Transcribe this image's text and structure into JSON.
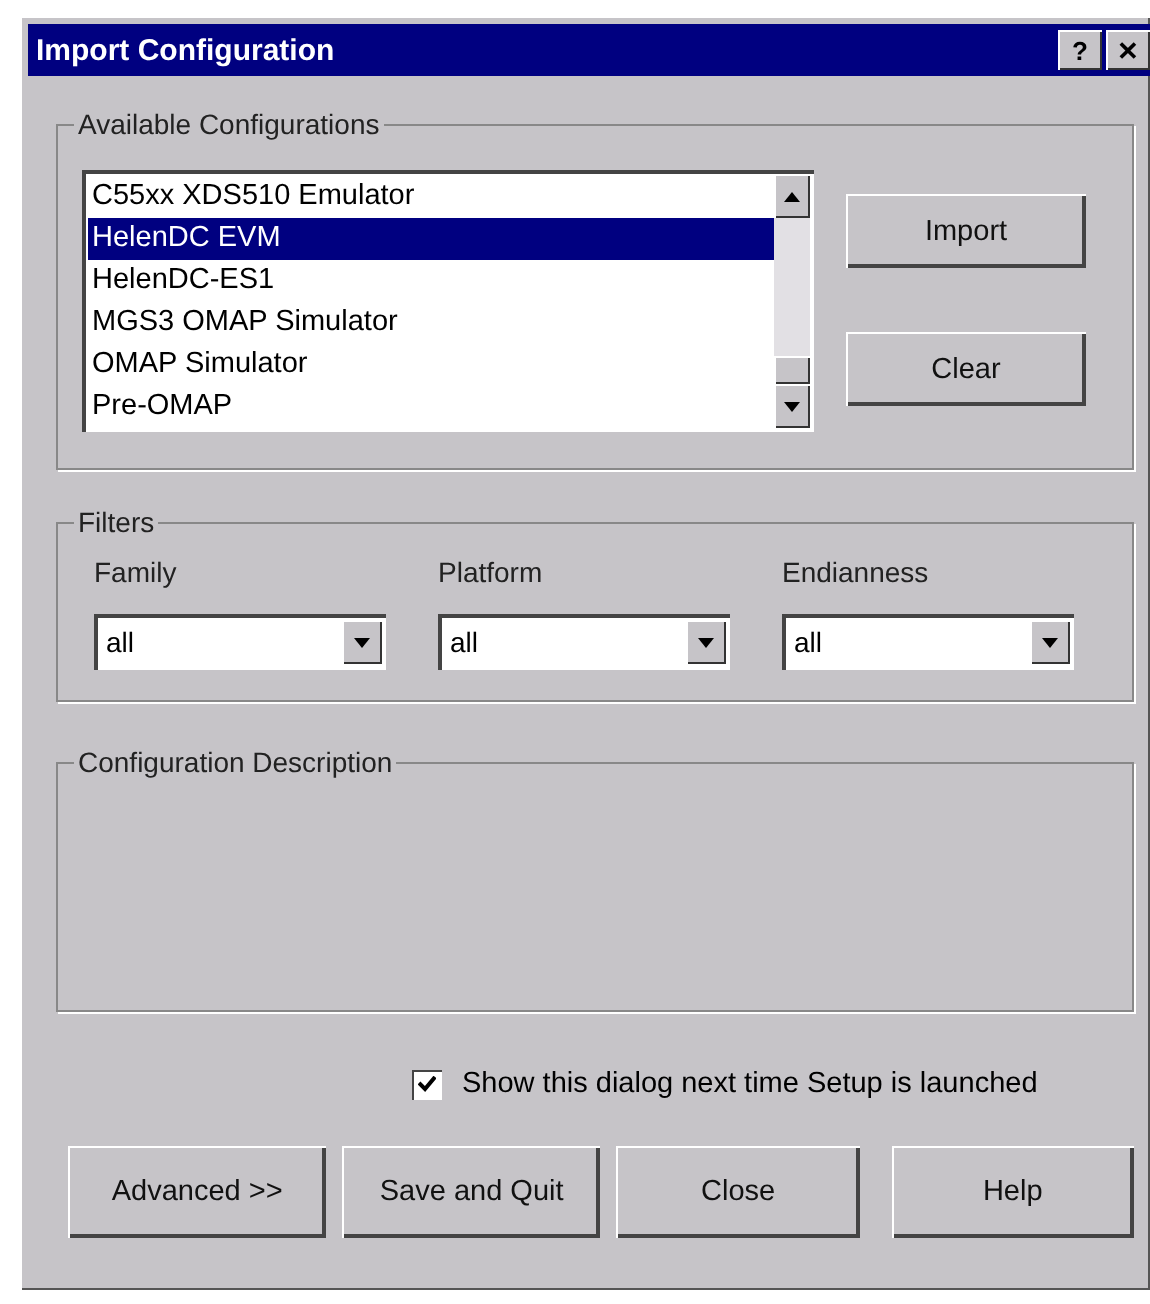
{
  "window": {
    "title": "Import Configuration",
    "help_button": "?",
    "close_button": "✕"
  },
  "available_configurations": {
    "label": "Available Configurations",
    "items": [
      {
        "label": "C55xx XDS510 Emulator",
        "selected": false
      },
      {
        "label": "HelenDC EVM",
        "selected": true
      },
      {
        "label": "HelenDC-ES1",
        "selected": false
      },
      {
        "label": "MGS3 OMAP Simulator",
        "selected": false
      },
      {
        "label": "OMAP Simulator",
        "selected": false
      },
      {
        "label": "Pre-OMAP",
        "selected": false
      }
    ],
    "buttons": [
      "Import",
      "Clear"
    ]
  },
  "filters": {
    "label": "Filters",
    "fields": [
      {
        "label": "Family",
        "value": "all"
      },
      {
        "label": "Platform",
        "value": "all"
      },
      {
        "label": "Endianness",
        "value": "all"
      }
    ]
  },
  "configuration_description": {
    "label": "Configuration Description"
  },
  "show_dialog": {
    "label": "Show this dialog next time Setup is launched",
    "checked": true
  },
  "buttons": [
    "Advanced >>",
    "Save and Quit",
    "Close",
    "Help"
  ]
}
